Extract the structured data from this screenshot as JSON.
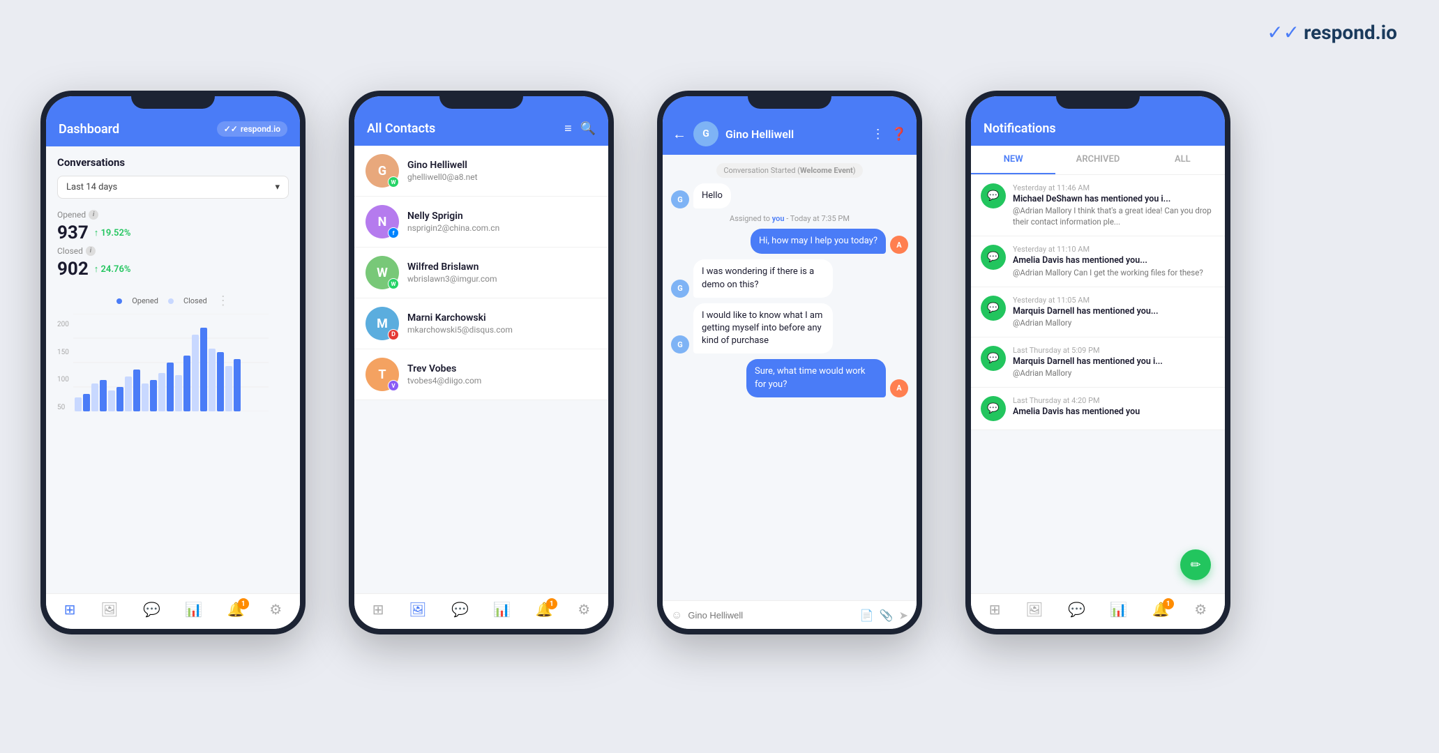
{
  "logo": {
    "text": "respond.io",
    "check_icon": "✓✓"
  },
  "phone1": {
    "header": {
      "title": "Dashboard",
      "badge": "respond.io"
    },
    "conversations_title": "Conversations",
    "dropdown": "Last 14 days",
    "stats": {
      "opened_label": "Opened",
      "opened_value": "937",
      "opened_change": "↑ 19.52%",
      "closed_label": "Closed",
      "closed_value": "902",
      "closed_change": "↑ 24.76%"
    },
    "chart": {
      "legend_opened": "Opened",
      "legend_closed": "Closed",
      "y_labels": [
        "200",
        "150",
        "100",
        "50"
      ]
    },
    "nav": {
      "items": [
        "⊞",
        "🖼",
        "💬",
        "📊",
        "🔔",
        "⚙"
      ]
    }
  },
  "phone2": {
    "header": {
      "title": "All Contacts"
    },
    "contacts": [
      {
        "name": "Gino Helliwell",
        "email": "ghelliwell0@a8.net",
        "color": "#e8a87c",
        "badge_class": "badge-wa",
        "badge_text": "W"
      },
      {
        "name": "Nelly Sprigin",
        "email": "nsprigin2@china.com.cn",
        "color": "#b57bee",
        "badge_class": "badge-fb",
        "badge_text": "f"
      },
      {
        "name": "Wilfred Brislawn",
        "email": "wbrislawn3@imgur.com",
        "color": "#78c878",
        "badge_class": "badge-wa",
        "badge_text": "W"
      },
      {
        "name": "Marni Karchowski",
        "email": "mkarchowski5@disqus.com",
        "color": "#5badde",
        "badge_class": "badge-discord",
        "badge_text": "D"
      },
      {
        "name": "Trev Vobes",
        "email": "tvobes4@diigo.com",
        "color": "#f4a261",
        "badge_class": "badge-viber",
        "badge_text": "V"
      }
    ]
  },
  "phone3": {
    "header": {
      "contact_name": "Gino Helliwell"
    },
    "messages": [
      {
        "type": "system",
        "text": "Conversation Started (Welcome Event)"
      },
      {
        "type": "left",
        "text": "Hello"
      },
      {
        "type": "system",
        "text": "Assigned to you - Today at 7:35 PM"
      },
      {
        "type": "right",
        "text": "Hi, how may I help you today?"
      },
      {
        "type": "left",
        "text": "I was wondering if there is a demo on this?"
      },
      {
        "type": "left",
        "text": "I would like to know what I am getting myself into before any kind of purchase"
      },
      {
        "type": "right",
        "text": "Sure, what time would work for you?"
      }
    ],
    "input_placeholder": "Gino Helliwell"
  },
  "phone4": {
    "header": {
      "title": "Notifications"
    },
    "tabs": [
      "NEW",
      "ARCHIVED",
      "ALL"
    ],
    "active_tab": 0,
    "notifications": [
      {
        "title": "Michael DeShawn has mentioned you i...",
        "time": "Yesterday at 11:46 AM",
        "preview": "@Adrian Mallory I think that's a great idea! Can you drop their contact information ple..."
      },
      {
        "title": "Amelia Davis has mentioned you...",
        "time": "Yesterday at 11:10 AM",
        "preview": "@Adrian Mallory Can I get the working files for these?"
      },
      {
        "title": "Marquis Darnell has mentioned you...",
        "time": "Yesterday at 11:05 AM",
        "preview": "@Adrian Mallory"
      },
      {
        "title": "Marquis Darnell has mentioned you i...",
        "time": "Last Thursday at 5:09 PM",
        "preview": "@Adrian Mallory"
      },
      {
        "title": "Amelia Davis has mentioned you",
        "time": "Last Thursday at 4:20 PM",
        "preview": ""
      }
    ]
  }
}
